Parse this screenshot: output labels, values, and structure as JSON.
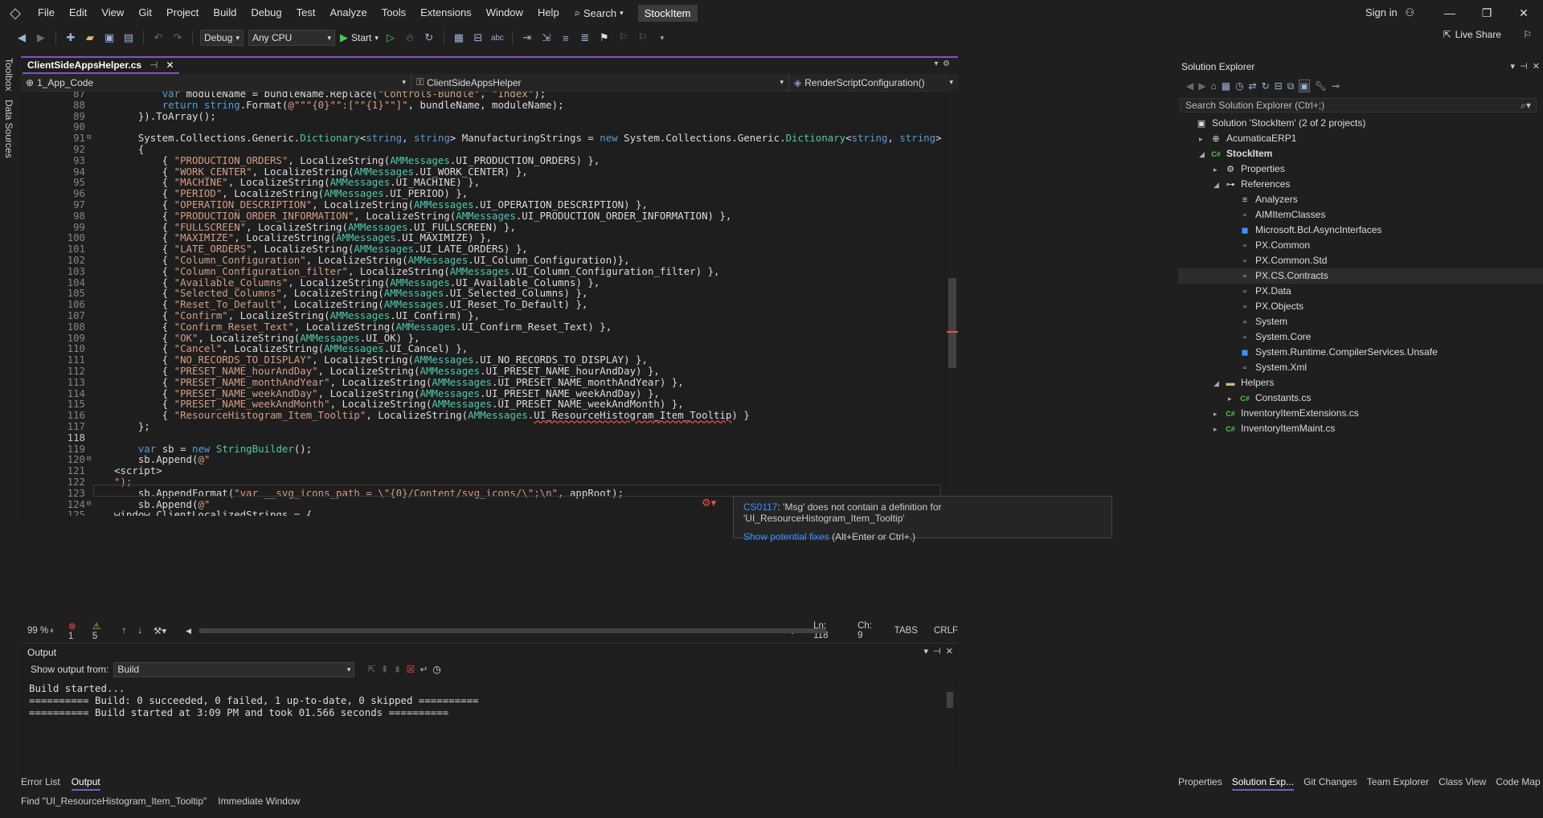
{
  "menu": {
    "items": [
      "File",
      "Edit",
      "View",
      "Git",
      "Project",
      "Build",
      "Debug",
      "Test",
      "Analyze",
      "Tools",
      "Extensions",
      "Window",
      "Help"
    ],
    "search_label": "Search",
    "solution_name": "StockItem",
    "sign_in": "Sign in"
  },
  "toolbar": {
    "config": "Debug",
    "platform": "Any CPU",
    "start_label": "Start",
    "live_share": "Live Share"
  },
  "left_strip": {
    "toolbox": "Toolbox",
    "data_sources": "Data Sources"
  },
  "editor": {
    "tab_title": "ClientSideAppsHelper.cs",
    "nav_project": "1_App_Code",
    "nav_class": "ClientSideAppsHelper",
    "nav_member": "RenderScriptConfiguration()",
    "lines": [
      {
        "n": "87",
        "t": "        var moduleName = bundleName.Replace(\"Controls-Bundle\", \"Index\");"
      },
      {
        "n": "88",
        "t": "        return string.Format(@\"\"\"{0}\"\":[\"\"{1}\"\"]\", bundleName, moduleName);"
      },
      {
        "n": "89",
        "t": "    }).ToArray();"
      },
      {
        "n": "90",
        "t": ""
      },
      {
        "n": "91",
        "t": "    System.Collections.Generic.Dictionary<string, string> ManufacturingStrings = new System.Collections.Generic.Dictionary<string, string>"
      },
      {
        "n": "92",
        "t": "    {"
      },
      {
        "n": "93",
        "t": "        { \"PRODUCTION_ORDERS\", LocalizeString(AMMessages.UI_PRODUCTION_ORDERS) },"
      },
      {
        "n": "94",
        "t": "        { \"WORK_CENTER\", LocalizeString(AMMessages.UI_WORK_CENTER) },"
      },
      {
        "n": "95",
        "t": "        { \"MACHINE\", LocalizeString(AMMessages.UI_MACHINE) },"
      },
      {
        "n": "96",
        "t": "        { \"PERIOD\", LocalizeString(AMMessages.UI_PERIOD) },"
      },
      {
        "n": "97",
        "t": "        { \"OPERATION_DESCRIPTION\", LocalizeString(AMMessages.UI_OPERATION_DESCRIPTION) },"
      },
      {
        "n": "98",
        "t": "        { \"PRODUCTION_ORDER_INFORMATION\", LocalizeString(AMMessages.UI_PRODUCTION_ORDER_INFORMATION) },"
      },
      {
        "n": "99",
        "t": "        { \"FULLSCREEN\", LocalizeString(AMMessages.UI_FULLSCREEN) },"
      },
      {
        "n": "100",
        "t": "        { \"MAXIMIZE\", LocalizeString(AMMessages.UI_MAXIMIZE) },"
      },
      {
        "n": "101",
        "t": "        { \"LATE_ORDERS\", LocalizeString(AMMessages.UI_LATE_ORDERS) },"
      },
      {
        "n": "102",
        "t": "        { \"Column_Configuration\", LocalizeString(AMMessages.UI_Column_Configuration)},"
      },
      {
        "n": "103",
        "t": "        { \"Column_Configuration_filter\", LocalizeString(AMMessages.UI_Column_Configuration_filter) },"
      },
      {
        "n": "104",
        "t": "        { \"Available_Columns\", LocalizeString(AMMessages.UI_Available_Columns) },"
      },
      {
        "n": "105",
        "t": "        { \"Selected_Columns\", LocalizeString(AMMessages.UI_Selected_Columns) },"
      },
      {
        "n": "106",
        "t": "        { \"Reset_To_Default\", LocalizeString(AMMessages.UI_Reset_To_Default) },"
      },
      {
        "n": "107",
        "t": "        { \"Confirm\", LocalizeString(AMMessages.UI_Confirm) },"
      },
      {
        "n": "108",
        "t": "        { \"Confirm_Reset_Text\", LocalizeString(AMMessages.UI_Confirm_Reset_Text) },"
      },
      {
        "n": "109",
        "t": "        { \"OK\", LocalizeString(AMMessages.UI_OK) },"
      },
      {
        "n": "110",
        "t": "        { \"Cancel\", LocalizeString(AMMessages.UI_Cancel) },"
      },
      {
        "n": "111",
        "t": "        { \"NO_RECORDS_TO_DISPLAY\", LocalizeString(AMMessages.UI_NO_RECORDS_TO_DISPLAY) },"
      },
      {
        "n": "112",
        "t": "        { \"PRESET_NAME_hourAndDay\", LocalizeString(AMMessages.UI_PRESET_NAME_hourAndDay) },"
      },
      {
        "n": "113",
        "t": "        { \"PRESET_NAME_monthAndYear\", LocalizeString(AMMessages.UI_PRESET_NAME_monthAndYear) },"
      },
      {
        "n": "114",
        "t": "        { \"PRESET_NAME_weekAndDay\", LocalizeString(AMMessages.UI_PRESET_NAME_weekAndDay) },"
      },
      {
        "n": "115",
        "t": "        { \"PRESET_NAME_weekAndMonth\", LocalizeString(AMMessages.UI_PRESET_NAME_weekAndMonth) },"
      },
      {
        "n": "116",
        "t": "        { \"ResourceHistogram_Item_Tooltip\", LocalizeString(AMMessages.UI_ResourceHistogram_Item_Tooltip) }"
      },
      {
        "n": "117",
        "t": "    };"
      },
      {
        "n": "118",
        "t": ""
      },
      {
        "n": "119",
        "t": "    var sb = new StringBuilder();"
      },
      {
        "n": "120",
        "t": "    sb.Append(@\""
      },
      {
        "n": "121",
        "t": "<script>"
      },
      {
        "n": "122",
        "t": "\");"
      },
      {
        "n": "123",
        "t": "    sb.AppendFormat(\"var __svg_icons_path = \\\"{0}/Content/svg_icons/\\\";\\n\", appRoot);"
      },
      {
        "n": "124",
        "t": "    sb.Append(@\""
      },
      {
        "n": "125",
        "t": "window.ClientLocalizedStrings = {"
      },
      {
        "n": "126",
        "t": "\");"
      }
    ],
    "tooltip": {
      "code": "CS0117",
      "message": ": 'Msg' does not contain a definition for 'UI_ResourceHistogram_Item_Tooltip'",
      "fix_link": "Show potential fixes",
      "fix_shortcut": " (Alt+Enter or Ctrl+.)"
    },
    "status": {
      "zoom": "99 %",
      "errors": "1",
      "warnings": "5",
      "position_ln": "Ln: 118",
      "position_ch": "Ch: 9",
      "tabs": "TABS",
      "eol": "CRLF"
    }
  },
  "output": {
    "title": "Output",
    "show_from_label": "Show output from:",
    "source": "Build",
    "lines": [
      "Build started...",
      "========== Build: 0 succeeded, 0 failed, 1 up-to-date, 0 skipped ==========",
      "========== Build started at 3:09 PM and took 01.566 seconds =========="
    ]
  },
  "bottom_tabs": [
    "Error List",
    "Output"
  ],
  "find_tabs": [
    "Find \"UI_ResourceHistogram_Item_Tooltip\"",
    "Immediate Window"
  ],
  "solution_explorer": {
    "title": "Solution Explorer",
    "search_placeholder": "Search Solution Explorer (Ctrl+;)",
    "tree": [
      {
        "label": "Solution 'StockItem' (2 of 2 projects)",
        "indent": 0,
        "icon": "solution-icon",
        "glyph": "▣",
        "twisty": ""
      },
      {
        "label": "AcumaticaERP1",
        "indent": 1,
        "icon": "website-icon",
        "glyph": "⊕",
        "twisty": "▸"
      },
      {
        "label": "StockItem",
        "indent": 1,
        "icon": "csharp-project-icon",
        "glyph": "C#",
        "twisty": "◢",
        "bold": true
      },
      {
        "label": "Properties",
        "indent": 2,
        "icon": "wrench-icon",
        "glyph": "⚙",
        "twisty": "▸"
      },
      {
        "label": "References",
        "indent": 2,
        "icon": "references-icon",
        "glyph": "⊶",
        "twisty": "◢"
      },
      {
        "label": "Analyzers",
        "indent": 3,
        "icon": "analyzer-icon",
        "glyph": "≡",
        "twisty": ""
      },
      {
        "label": "AIMItemClasses",
        "indent": 3,
        "icon": "reference-icon",
        "glyph": "▫",
        "twisty": ""
      },
      {
        "label": "Microsoft.Bcl.AsyncInterfaces",
        "indent": 3,
        "icon": "package-icon",
        "glyph": "◼",
        "twisty": ""
      },
      {
        "label": "PX.Common",
        "indent": 3,
        "icon": "reference-icon",
        "glyph": "▫",
        "twisty": ""
      },
      {
        "label": "PX.Common.Std",
        "indent": 3,
        "icon": "reference-icon",
        "glyph": "▫",
        "twisty": ""
      },
      {
        "label": "PX.CS.Contracts",
        "indent": 3,
        "icon": "reference-icon",
        "glyph": "▫",
        "twisty": "",
        "selected": true
      },
      {
        "label": "PX.Data",
        "indent": 3,
        "icon": "reference-icon",
        "glyph": "▫",
        "twisty": ""
      },
      {
        "label": "PX.Objects",
        "indent": 3,
        "icon": "reference-icon",
        "glyph": "▫",
        "twisty": ""
      },
      {
        "label": "System",
        "indent": 3,
        "icon": "reference-icon",
        "glyph": "▫",
        "twisty": ""
      },
      {
        "label": "System.Core",
        "indent": 3,
        "icon": "reference-icon",
        "glyph": "▫",
        "twisty": ""
      },
      {
        "label": "System.Runtime.CompilerServices.Unsafe",
        "indent": 3,
        "icon": "package-icon",
        "glyph": "◼",
        "twisty": ""
      },
      {
        "label": "System.Xml",
        "indent": 3,
        "icon": "reference-icon",
        "glyph": "▫",
        "twisty": ""
      },
      {
        "label": "Helpers",
        "indent": 2,
        "icon": "folder-icon",
        "glyph": "▬",
        "twisty": "◢"
      },
      {
        "label": "Constants.cs",
        "indent": 3,
        "icon": "csharp-file-icon",
        "glyph": "C#",
        "twisty": "▸"
      },
      {
        "label": "InventoryItemExtensions.cs",
        "indent": 2,
        "icon": "csharp-file-icon",
        "glyph": "C#",
        "twisty": "▸"
      },
      {
        "label": "InventoryItemMaint.cs",
        "indent": 2,
        "icon": "csharp-file-icon",
        "glyph": "C#",
        "twisty": "▸"
      }
    ],
    "bottom_tabs": [
      "Properties",
      "Solution Exp...",
      "Git Changes",
      "Team Explorer",
      "Class View",
      "Code Map"
    ]
  },
  "colors": {
    "accent": "#7e57c2",
    "keyword": "#569cd6",
    "string": "#d69d85",
    "type": "#4ec9b0",
    "error": "#f14c4c",
    "link": "#3794ff"
  }
}
